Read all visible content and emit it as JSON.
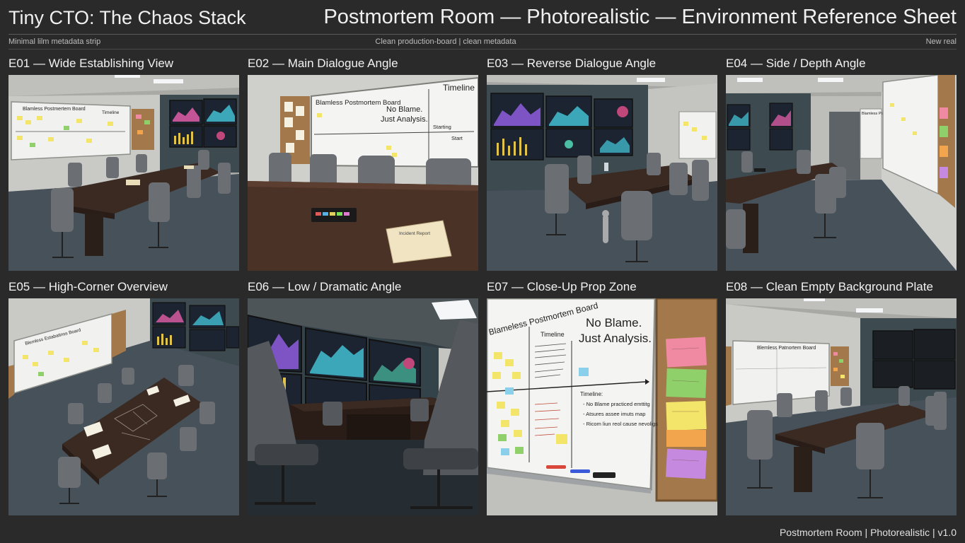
{
  "header": {
    "left_title": "Tiny CTO: The Chaos Stack",
    "right_title": "Postmortem Room — Photorealistic — Environment Reference Sheet",
    "meta_left": "Minimal lilm metadata strip",
    "meta_center": "Clean production-board | clean metadata",
    "meta_right": "New real"
  },
  "panels": [
    {
      "title": "E01 — Wide Establishing View",
      "board_title": "Blamless Postmertem Board",
      "board_label": "Timeline"
    },
    {
      "title": "E02 — Main Dialogue Angle",
      "board_title": "Blamless Postmortem Board",
      "board_label": "Timeline",
      "board_text_1": "No Blame.",
      "board_text_2": "Just Analysis.",
      "board_note_1": "Starting",
      "board_note_2": "Start",
      "folder_label": "Incident Report"
    },
    {
      "title": "E03 — Reverse Dialogue Angle"
    },
    {
      "title": "E04 — Side / Depth Angle",
      "board_title": "Blamless Plan"
    },
    {
      "title": "E05 — High-Corner Overview",
      "board_title": "Blemless Estabatinss Board"
    },
    {
      "title": "E06 — Low / Dramatic Angle"
    },
    {
      "title": "E07 — Close-Up Prop Zone",
      "board_title": "Blameless Postmortem Board",
      "board_label": "Timeline",
      "board_text_1": "No Blame.",
      "board_text_2": "Just Analysis.",
      "timeline_title": "Timeline:",
      "timeline_items": [
        "- No Blame practiced emttitg",
        "- Atsures assee imuts map",
        "- Ricom liun reol cause nevoligs"
      ]
    },
    {
      "title": "E08 — Clean Empty Background Plate",
      "board_title": "Blemless Patnortem Board"
    }
  ],
  "footer": {
    "text": "Postmortem Room | Photorealistic | v1.0"
  },
  "colors": {
    "background": "#2a2a2a",
    "wall": "#c9c9c5",
    "accent_wall": "#3d4a50",
    "floor": "#46515a",
    "table": "#3a2a22",
    "chair": "#6b6e72",
    "cork": "#a3784a",
    "sticky_yellow": "#f3e46a",
    "sticky_pink": "#f08aa3",
    "sticky_green": "#8fd06b",
    "sticky_orange": "#f2a54d",
    "sticky_purple": "#c58ae0"
  }
}
